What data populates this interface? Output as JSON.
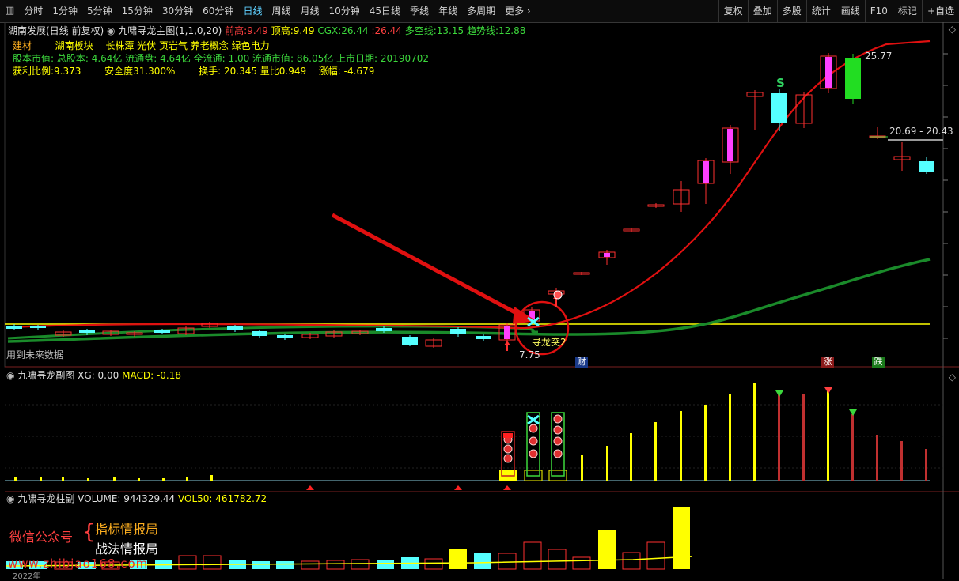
{
  "toolbar": {
    "periods": [
      "分时",
      "1分钟",
      "5分钟",
      "15分钟",
      "30分钟",
      "60分钟",
      "日线",
      "周线",
      "月线",
      "10分钟",
      "45日线",
      "季线",
      "年线",
      "多周期",
      "更多"
    ],
    "active_period": "日线",
    "tools": [
      "复权",
      "叠加",
      "多股",
      "统计",
      "画线",
      "F10",
      "标记",
      "+自选"
    ]
  },
  "main_panel": {
    "stock_title": "湖南发展(日线 前复权)",
    "indicator_name": "九啸寻龙主图(1,1,0,20)",
    "qian_gao_label": "前高:",
    "qian_gao_value": "9.49",
    "ding_gao_label": "顶高:",
    "ding_gao_value": "9.49",
    "cgx_label": "CGX:",
    "cgx_value": "26.44",
    "sep_value": ":26.44",
    "duokong_label": "多空线:",
    "duokong_value": "13.15",
    "qushi_label": "趋势线:",
    "qushi_value": "12.88",
    "sector": "建材",
    "region": "湖南板块",
    "concepts": "长株潭 光伏 页岩气 养老概念 绿色电力",
    "info_line": "股本市值: 总股本: 4.64亿 流通盘: 4.64亿 全流通: 1.00 流通市值: 86.05亿 上市日期: 20190702",
    "profit_ratio": "获利比例:9.373",
    "safety": "安全度31.300%",
    "turnover": "换手: 20.345 量比0.949",
    "change": "涨幅: -4.679",
    "future_data_note": "用到未来数据",
    "high_marker": "25.77",
    "low_marker": "7.75",
    "range_label": "20.69 - 20.43",
    "signal_label": "寻龙突2",
    "s_marker": "S",
    "cai_badge": "财",
    "zhang_badge": "涨",
    "die_badge": "跌"
  },
  "sub_panel": {
    "title": "九啸寻龙副图",
    "xg_label": "XG:",
    "xg_value": "0.00",
    "macd_label": "MACD:",
    "macd_value": "-0.18"
  },
  "volume_panel": {
    "title": "九啸寻龙柱副",
    "volume_label": "VOLUME:",
    "volume_value": "944329.44",
    "vol50_label": "VOL50:",
    "vol50_value": "461782.72",
    "wechat_label": "微信公众号",
    "brand_line1": "指标情报局",
    "brand_line2": "战法情报局",
    "watermark": "www.zhibiao168.com",
    "date_label": "2022年"
  },
  "colors": {
    "up_candle": "#ff3030",
    "down_candle": "#55ffff",
    "signal_fill": "#ff40ff",
    "ma_red": "#e01010",
    "ma_green": "#1a8a2a",
    "line_yellow": "#ffff00"
  }
}
